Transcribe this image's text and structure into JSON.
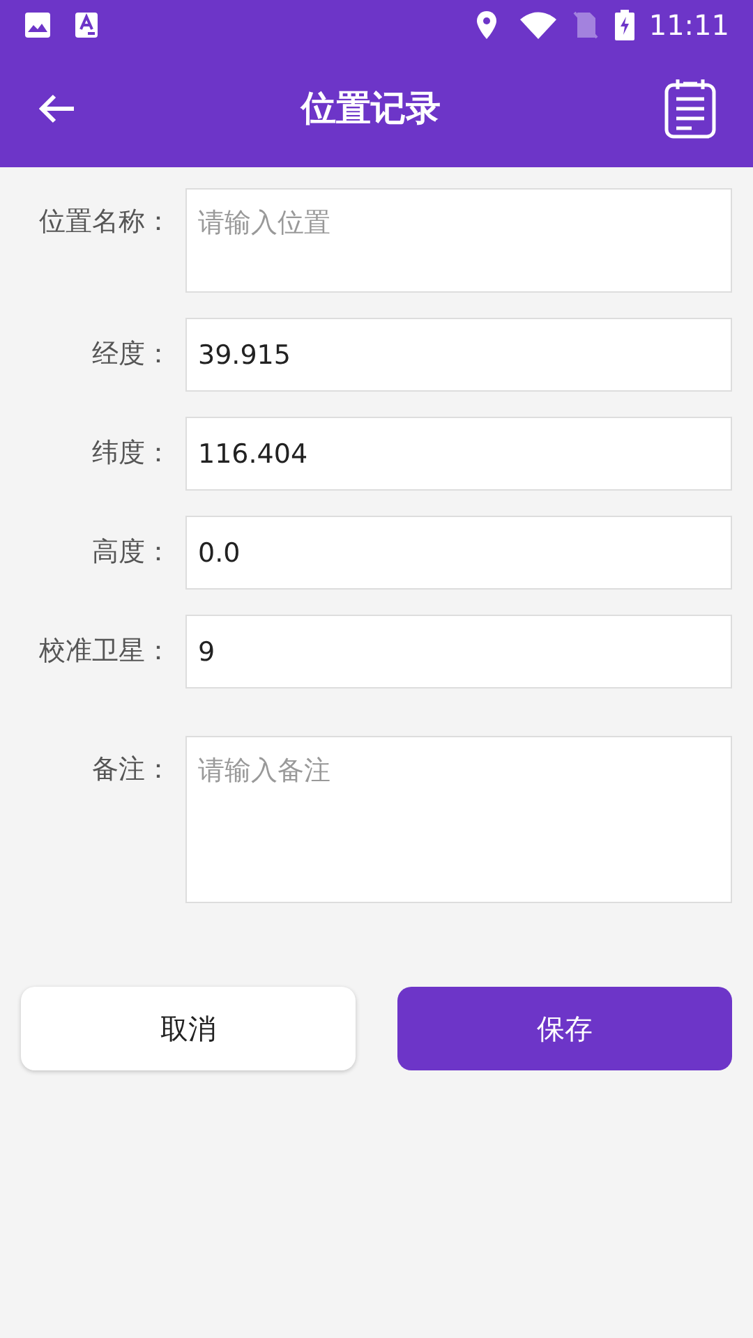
{
  "status_bar": {
    "time": "11:11"
  },
  "app_bar": {
    "title": "位置记录"
  },
  "form": {
    "fields": [
      {
        "label": "位置名称：",
        "placeholder": "请输入位置",
        "kind": "short_multiline"
      },
      {
        "label": "经度：",
        "value": "39.915",
        "kind": "single"
      },
      {
        "label": "纬度：",
        "value": "116.404",
        "kind": "single"
      },
      {
        "label": "高度：",
        "value": "0.0",
        "kind": "single"
      },
      {
        "label": "校准卫星：",
        "value": "9",
        "kind": "single"
      },
      {
        "label": "备注：",
        "placeholder": "请输入备注",
        "kind": "multiline"
      }
    ]
  },
  "buttons": [
    {
      "label": "取消",
      "kind": "secondary"
    },
    {
      "label": "保存",
      "kind": "primary"
    }
  ]
}
